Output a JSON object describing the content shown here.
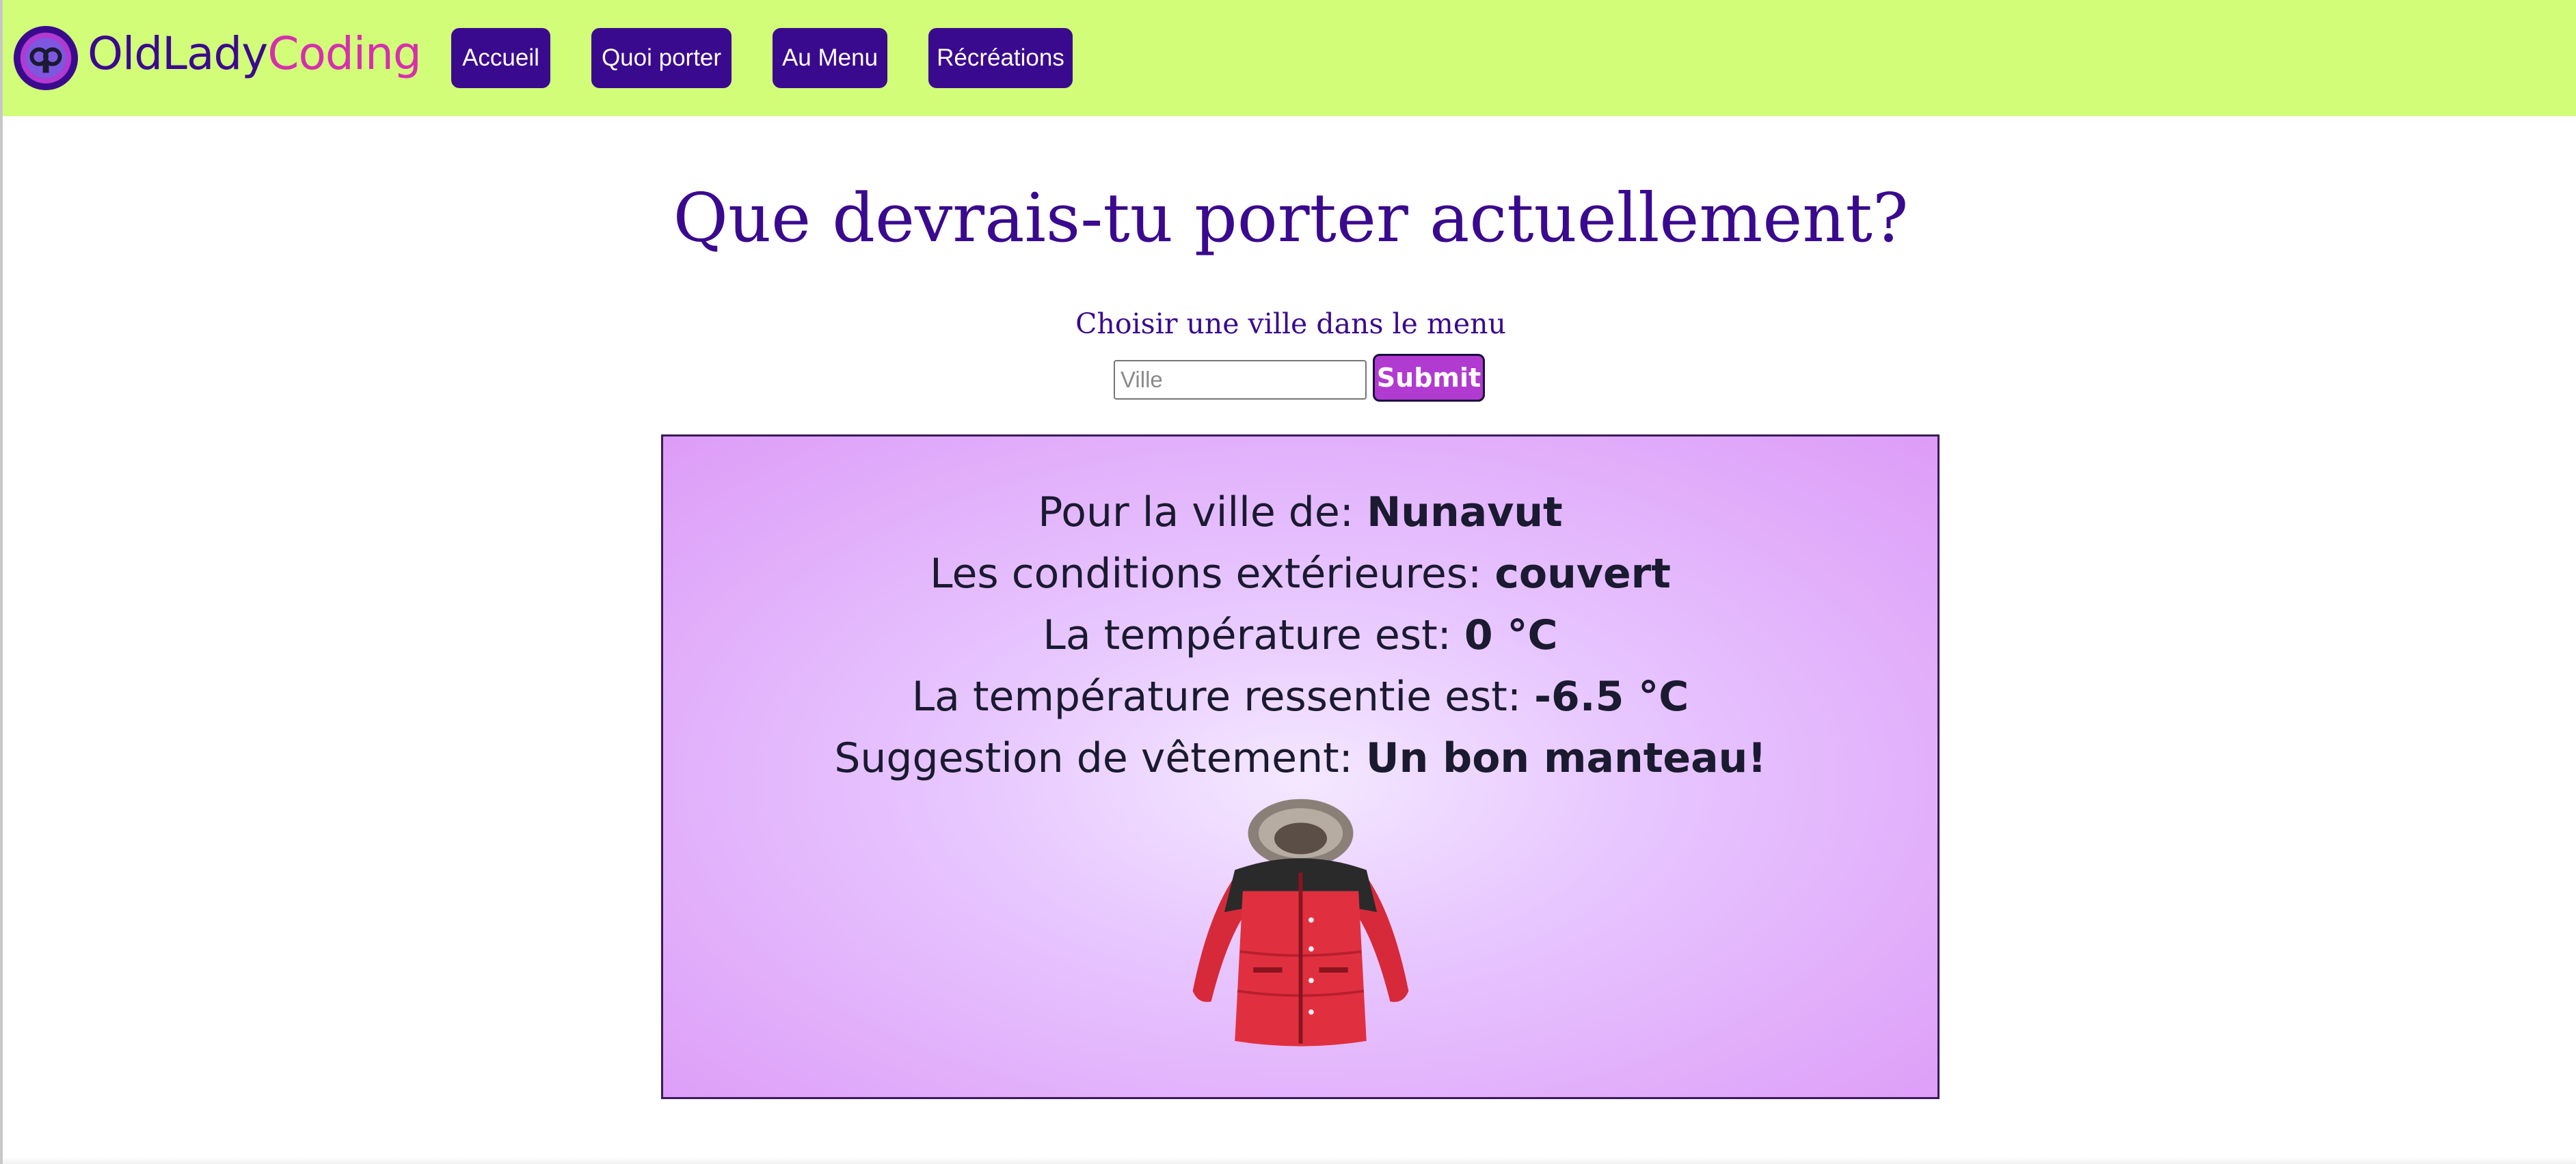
{
  "header": {
    "brand_part1": "OldLady",
    "brand_part2": "Coding",
    "nav": [
      "Accueil",
      "Quoi porter",
      "Au Menu",
      "Récréations"
    ]
  },
  "main": {
    "title": "Que devrais-tu porter actuellement?",
    "subtitle": "Choisir une ville dans le menu",
    "city_placeholder": "Ville",
    "city_value": "",
    "submit_label": "Submit"
  },
  "result": {
    "city_label": "Pour la ville de: ",
    "city_value": "Nunavut",
    "conditions_label": "Les conditions extérieures: ",
    "conditions_value": "couvert",
    "temp_label": "La température est: ",
    "temp_value": "0 °C",
    "feels_label": "La température ressentie est: ",
    "feels_value": "-6.5 °C",
    "suggestion_label": "Suggestion de vêtement: ",
    "suggestion_value": "Un bon manteau!",
    "image_icon": "winter-jacket"
  },
  "colors": {
    "header_bg": "#d2fd78",
    "primary": "#3a0a8e",
    "accent": "#d62fae",
    "submit_bg": "#b13ad0",
    "panel_bg": "#e7c6ff"
  }
}
